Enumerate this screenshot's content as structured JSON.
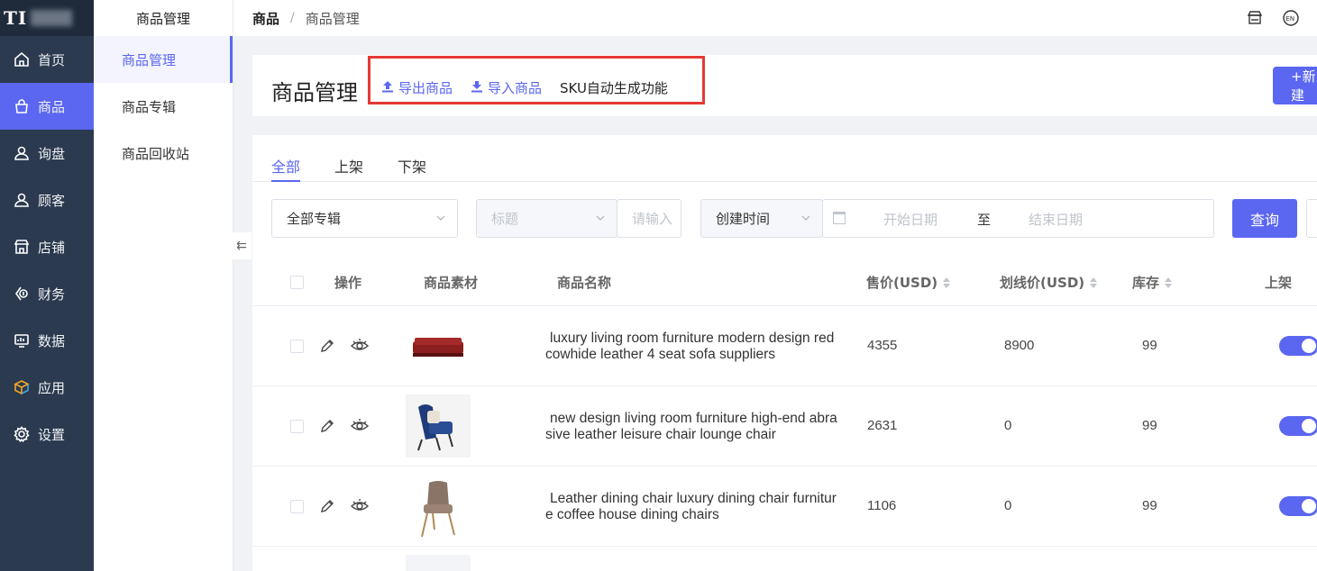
{
  "logo": {
    "text": "TI"
  },
  "nav": [
    {
      "label": "首页",
      "icon": "home-icon",
      "active": false
    },
    {
      "label": "商品",
      "icon": "bag-icon",
      "active": true
    },
    {
      "label": "询盘",
      "icon": "user-icon",
      "active": false
    },
    {
      "label": "顾客",
      "icon": "user-icon",
      "active": false
    },
    {
      "label": "店铺",
      "icon": "shop-icon",
      "active": false
    },
    {
      "label": "财务",
      "icon": "finance-icon",
      "active": false
    },
    {
      "label": "数据",
      "icon": "monitor-icon",
      "active": false
    },
    {
      "label": "应用",
      "icon": "cube-icon",
      "active": false
    },
    {
      "label": "设置",
      "icon": "gear-icon",
      "active": false
    }
  ],
  "submenu": {
    "title": "商品管理",
    "items": [
      "商品管理",
      "商品专辑",
      "商品回收站"
    ]
  },
  "breadcrumb": {
    "root": "商品",
    "separator": "/",
    "current": "商品管理"
  },
  "header": {
    "title": "商品管理",
    "export_label": "导出商品",
    "import_label": "导入商品",
    "sku_label": "SKU自动生成功能",
    "new_label": "+新建"
  },
  "tabs": [
    "全部",
    "上架",
    "下架"
  ],
  "filters": {
    "album": "全部专辑",
    "field": "标题",
    "keyword_placeholder": "请输入",
    "date_type": "创建时间",
    "start_placeholder": "开始日期",
    "to": "至",
    "end_placeholder": "结束日期",
    "query_label": "查询"
  },
  "table": {
    "columns": {
      "action": "操作",
      "media": "商品素材",
      "name": "商品名称",
      "price": "售价(USD)",
      "strike": "划线价(USD)",
      "stock": "库存",
      "listed": "上架"
    },
    "rows": [
      {
        "name_line1": "luxury living room furniture modern design red",
        "name_line2": "cowhide leather 4 seat sofa suppliers",
        "price": "4355",
        "strike": "8900",
        "stock": "99",
        "listed": true
      },
      {
        "name_line1": "new design living room furniture high-end abra",
        "name_line2": "sive leather leisure chair lounge chair",
        "price": "2631",
        "strike": "0",
        "stock": "99",
        "listed": true
      },
      {
        "name_line1": "Leather dining chair luxury dining chair furnitur",
        "name_line2": "e coffee house dining chairs",
        "price": "1106",
        "strike": "0",
        "stock": "99",
        "listed": true
      }
    ]
  },
  "colors": {
    "accent": "#5b67f0",
    "sidebar": "#2b3a4f",
    "highlight": "#e53935"
  }
}
